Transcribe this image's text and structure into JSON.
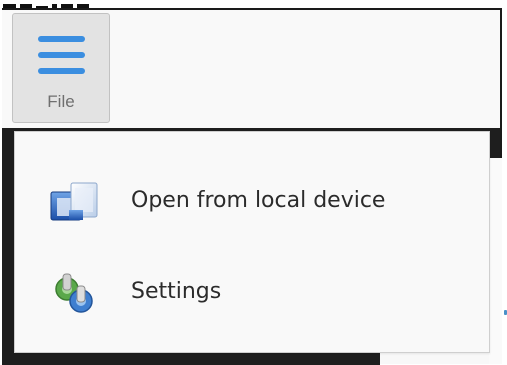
{
  "file_button": {
    "label": "File",
    "icon": "hamburger-menu-icon",
    "accent_color": "#3b8ee0"
  },
  "menu": {
    "items": [
      {
        "label": "Open from local device",
        "icon": "open-folder-icon"
      },
      {
        "label": "Settings",
        "icon": "settings-gears-icon"
      }
    ]
  }
}
